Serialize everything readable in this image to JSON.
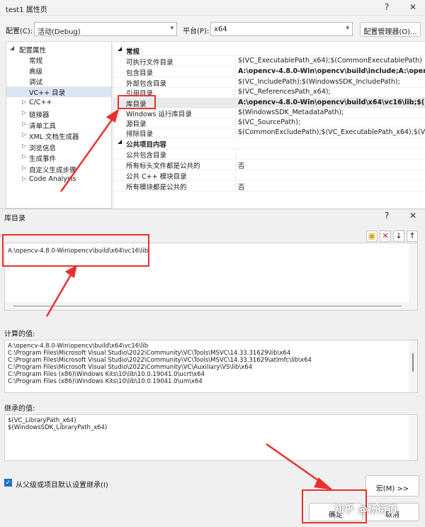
{
  "window": {
    "title": "test1 属性页",
    "help_glyph": "?",
    "close_glyph": "✕"
  },
  "toolbar": {
    "config_label": "配置(C):",
    "config_value": "活动(Debug)",
    "platform_label": "平台(P):",
    "platform_value": "x64",
    "manager_button": "配置管理器(O)..."
  },
  "tree": {
    "root": "配置属性",
    "items": [
      "常规",
      "高级",
      "调试",
      "VC++ 目录",
      "C/C++",
      "链接器",
      "清单工具",
      "XML 文档生成器",
      "浏览信息",
      "生成事件",
      "自定义生成步骤",
      "Code Analysis"
    ]
  },
  "grid": {
    "cat1": "常规",
    "rows": [
      {
        "k": "可执行文件目录",
        "v": "$(VC_ExecutablePath_x64);$(CommonExecutablePath)"
      },
      {
        "k": "包含目录",
        "v": "A:\\opencv-4.8.0-Win\\opencv\\build\\include;A:\\opencv-..."
      },
      {
        "k": "外部包含目录",
        "v": "$(VC_IncludePath);$(WindowsSDK_IncludePath);"
      },
      {
        "k": "引用目录",
        "v": "$(VC_ReferencesPath_x64);"
      },
      {
        "k": "库目录",
        "v": "A:\\opencv-4.8.0-Win\\opencv\\build\\x64\\vc16\\lib;$(Libr..."
      },
      {
        "k": "Windows 运行库目录",
        "v": "$(WindowsSDK_MetadataPath);"
      },
      {
        "k": "源目录",
        "v": "$(VC_SourcePath);"
      },
      {
        "k": "排除目录",
        "v": "$(CommonExcludePath);$(VC_ExecutablePath_x64);$(VC_Li..."
      }
    ],
    "cat2": "公共项目内容",
    "rows2": [
      {
        "k": "公共包含目录",
        "v": ""
      },
      {
        "k": "所有标头文件都是公共的",
        "v": "否"
      },
      {
        "k": "公共 C++ 模块目录",
        "v": ""
      },
      {
        "k": "所有模块都是公共的",
        "v": "否"
      }
    ]
  },
  "dialog": {
    "title": "库目录",
    "help_glyph": "?",
    "close_glyph": "✕",
    "entry": "A:\\opencv-4.8.0-Win\\opencv\\build\\x64\\vc16\\lib",
    "computed_label": "计算的值:",
    "computed": [
      "A:\\opencv-4.8.0-Win\\opencv\\build\\x64\\vc16\\lib",
      "C:\\Program Files\\Microsoft Visual Studio\\2022\\Community\\VC\\Tools\\MSVC\\14.33.31629\\lib\\x64",
      "C:\\Program Files\\Microsoft Visual Studio\\2022\\Community\\VC\\Tools\\MSVC\\14.33.31629\\atlmfc\\lib\\x64",
      "C:\\Program Files\\Microsoft Visual Studio\\2022\\Community\\VC\\Auxiliary\\VS\\lib\\x64",
      "C:\\Program Files (x86)\\Windows Kits\\10\\lib\\10.0.19041.0\\ucrt\\x64",
      "C:\\Program Files (x86)\\Windows Kits\\10\\lib\\10.0.19041.0\\um\\x64"
    ],
    "inherited_label": "继承的值:",
    "inherited": [
      "$(VC_LibraryPath_x64)",
      "$(WindowsSDK_LibraryPath_x64)"
    ],
    "inherit_check": "从父级或项目默认设置继承(I)",
    "macro_button": "宏(M) >>",
    "ok_button": "确定",
    "cancel_button": "取消"
  },
  "watermark": "知乎 @杨衍道",
  "colors": {
    "annotation": "#e8312e",
    "selection": "#dbe4f2",
    "checkbox": "#1e73c7"
  }
}
